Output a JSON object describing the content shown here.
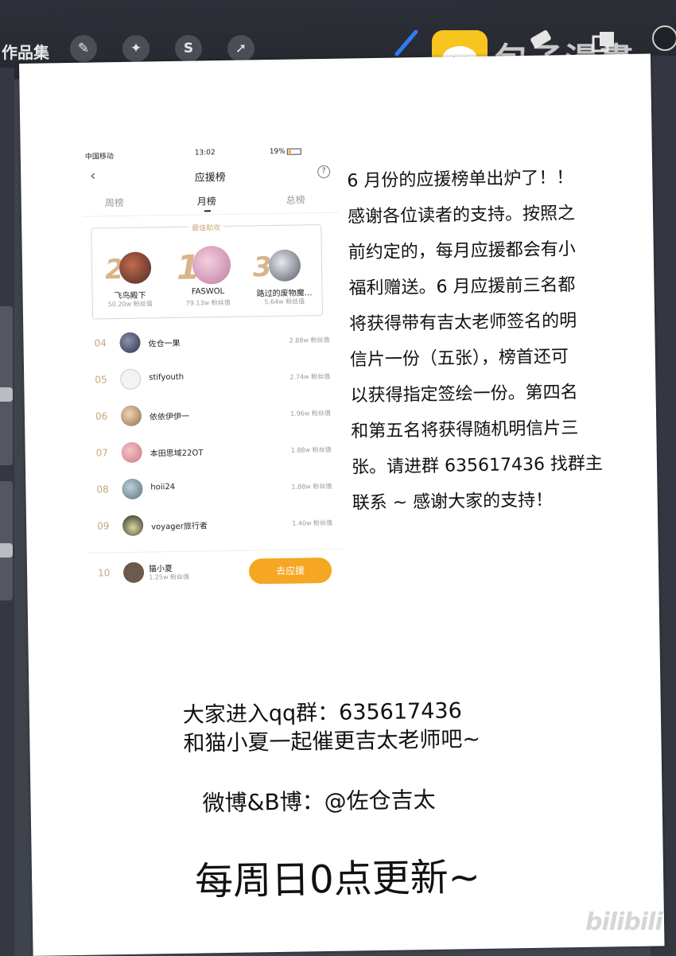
{
  "app": {
    "gallery_label": "作品集",
    "tools": [
      "wrench-icon",
      "magic-wand-icon",
      "selection-icon",
      "move-arrow-icon"
    ],
    "right_tools": [
      "brush-icon",
      "eraser-icon",
      "layers-icon",
      "color-circle"
    ]
  },
  "watermark": {
    "text": "包子漫畫",
    "bottom": "bilibili"
  },
  "phone": {
    "status": {
      "carrier": "中国移动",
      "time": "13:02",
      "battery": "19%"
    },
    "nav_title": "应援榜",
    "help": "?",
    "tabs": [
      "周榜",
      "月榜",
      "总榜"
    ],
    "top3_heading": "最佳助攻",
    "top3": [
      {
        "rank": "2",
        "name": "飞鸟殿下",
        "fans": "50.20w 粉丝值"
      },
      {
        "rank": "1",
        "name": "FASWOL",
        "fans": "79.13w 粉丝值"
      },
      {
        "rank": "3",
        "name": "路过的废物魔…",
        "fans": "5.64w 粉丝值"
      }
    ],
    "rows": [
      {
        "rank": "04",
        "name": "佐仓一果",
        "fans": "2.88w 粉丝值"
      },
      {
        "rank": "05",
        "name": "stifyouth",
        "fans": "2.74w 粉丝值"
      },
      {
        "rank": "06",
        "name": "依依伊伊一",
        "fans": "1.96w 粉丝值"
      },
      {
        "rank": "07",
        "name": "本田思域22OT",
        "fans": "1.88w 粉丝值"
      },
      {
        "rank": "08",
        "name": "hoii24",
        "fans": "1.88w 粉丝值"
      },
      {
        "rank": "09",
        "name": "voyager旅行者",
        "fans": "1.40w 粉丝值"
      }
    ],
    "me": {
      "rank": "10",
      "name": "猫小夏",
      "fans": "1.25w 粉丝值"
    },
    "support_button": "去应援"
  },
  "announcement": "6 月份的应援榜单出炉了！！\n感谢各位读者的支持。按照之\n前约定的，每月应援都会有小\n福利赠送。6 月应援前三名都\n将获得带有吉太老师签名的明\n信片一份（五张），榜首还可\n以获得指定签绘一份。第四名\n和第五名将获得随机明信片三\n张。请进群 635617436 找群主\n联系 ~ 感谢大家的支持！",
  "qq_lines": [
    "大家进入qq群：635617436",
    "和猫小夏一起催更吉太老师吧~"
  ],
  "weibo": "微博&B博：@佐仓吉太",
  "update": "每周日0点更新~"
}
